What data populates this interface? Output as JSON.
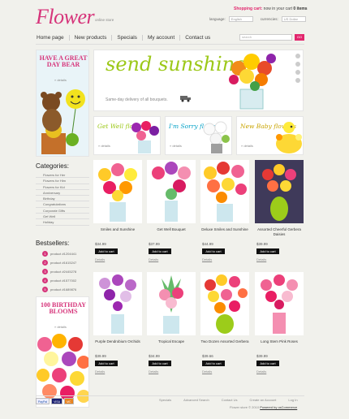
{
  "header": {
    "logo": "Flower",
    "logo_sub": "online store",
    "cart_prefix": "Shopping cart:",
    "cart_text": "now in your cart",
    "cart_count": "0 items",
    "language_label": "language:",
    "language_value": "English",
    "currencies_label": "currencies:",
    "currencies_value": "US Dollar"
  },
  "nav": [
    "Home page",
    "New products",
    "Specials",
    "My account",
    "Contact us"
  ],
  "search": {
    "placeholder": "search",
    "button": "GO"
  },
  "promos": {
    "bear": {
      "title": "HAVE A GREAT DAY BEAR",
      "details": "» details"
    },
    "hero": {
      "title": "send sunshine",
      "subtitle": "Same-day delivery of all bouquets."
    },
    "mini": [
      {
        "title": "Get Well flowers",
        "details": "» details"
      },
      {
        "title": "I'm Sorry flowers",
        "details": "» details"
      },
      {
        "title": "New Baby flowers",
        "details": "» details"
      }
    ],
    "birthday": {
      "title": "100 BIRTHDAY BLOOMS",
      "details": "» details"
    }
  },
  "categories": {
    "title": "Categories:",
    "items": [
      "Flowers for Her",
      "Flowers for Him",
      "Flowers for Kid",
      "Anniversary",
      "Birthday",
      "Congratulations",
      "Corporate Gifts",
      "Get Well",
      "Holiday"
    ]
  },
  "bestsellers": {
    "title": "Bestsellers:",
    "items": [
      "product #1204441",
      "product #1615247",
      "product #2445278",
      "product #1577002",
      "product #1689876"
    ]
  },
  "products": [
    {
      "name": "Smiles and Sunshine",
      "price": "$34.99",
      "button": "Add to cart",
      "details": "Details"
    },
    {
      "name": "Get Well Bouquet",
      "price": "$37.99",
      "button": "Add to cart",
      "details": "Details"
    },
    {
      "name": "Deluxe Smiles and Sunshine",
      "price": "$44.99",
      "button": "Add to cart",
      "details": "Details"
    },
    {
      "name": "Assorted Cheerful Gerbera Daisies",
      "price": "$39.99",
      "button": "Add to cart",
      "details": "Details"
    },
    {
      "name": "Purple Dendrobium Orchids",
      "price": "$39.99",
      "button": "Add to cart",
      "details": "Details"
    },
    {
      "name": "Tropical Escape",
      "price": "$34.99",
      "button": "Add to cart",
      "details": "Details"
    },
    {
      "name": "Two Dozen Assorted Gerbera",
      "price": "$39.66",
      "button": "Add to cart",
      "details": "Details"
    },
    {
      "name": "Long Stem Pink Roses",
      "price": "$39.99",
      "button": "Add to cart",
      "details": "Details"
    }
  ],
  "footer": {
    "links": [
      "Specials",
      "Advanced Search",
      "Contact Us",
      "Create an Account",
      "Log In"
    ],
    "copyright": "Flower store © 2010",
    "powered": "Powered by osCommerce",
    "payments": [
      "PayPal",
      "VISA",
      "MC"
    ]
  },
  "colors": {
    "brand": "#d6347a",
    "accent": "#e2266d",
    "hero_green": "#9cc818"
  }
}
